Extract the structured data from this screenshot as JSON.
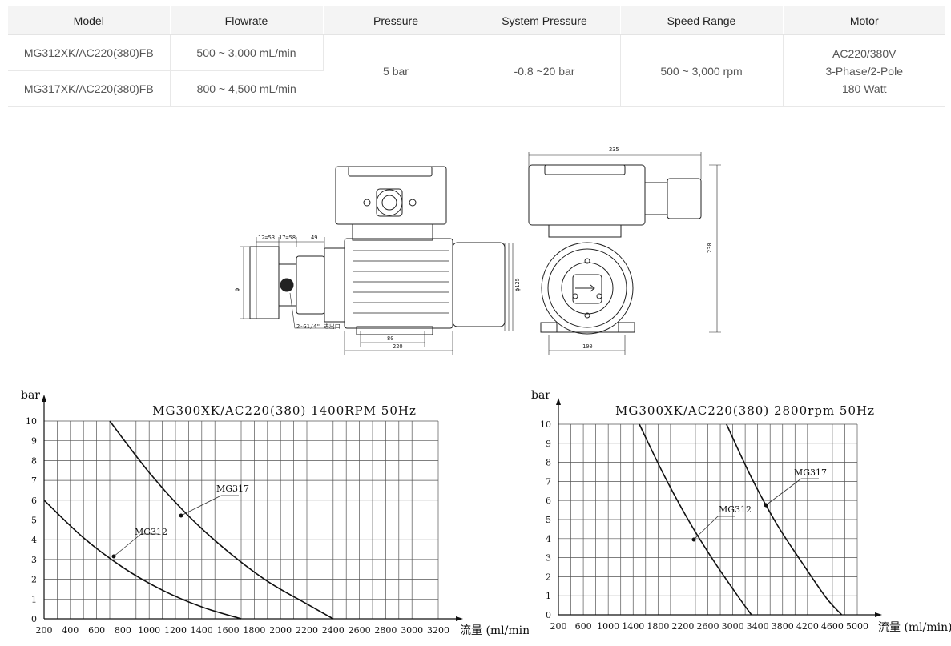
{
  "table": {
    "headers": [
      "Model",
      "Flowrate",
      "Pressure",
      "System Pressure",
      "Speed Range",
      "Motor"
    ],
    "rows": [
      {
        "model": "MG312XK/AC220(380)FB",
        "flowrate": "500 ~ 3,000 mL/min"
      },
      {
        "model": "MG317XK/AC220(380)FB",
        "flowrate": "800 ~ 4,500 mL/min"
      }
    ],
    "pressure": "5 bar",
    "system_pressure": "-0.8 ~20 bar",
    "speed_range": "500 ~ 3,000 rpm",
    "motor": [
      "AC220/380V",
      "3-Phase/2-Pole",
      "180 Watt"
    ]
  },
  "drawing": {
    "dims": [
      "12=53",
      "17=58",
      "49",
      "80",
      "220",
      "235",
      "230",
      "100",
      "ϕ125",
      "ϕ"
    ],
    "port_label": "2-G1/4\" 进出口"
  },
  "chart_data": [
    {
      "type": "line",
      "title": "MG300XK/AC220(380)  1400RPM  50Hz",
      "ylabel": "bar",
      "xlabel": "流量 (ml/min)",
      "x_ticks": [
        200,
        400,
        600,
        800,
        1000,
        1200,
        1400,
        1600,
        1800,
        2000,
        2200,
        2400,
        2600,
        2800,
        3000,
        3200
      ],
      "y_ticks": [
        0,
        1,
        2,
        3,
        4,
        5,
        6,
        7,
        8,
        9,
        10
      ],
      "xlim": [
        200,
        3200
      ],
      "ylim": [
        0,
        10
      ],
      "grid": true,
      "series": [
        {
          "name": "MG312",
          "x": [
            200,
            500,
            800,
            1100,
            1400,
            1700
          ],
          "y": [
            6,
            4.1,
            2.6,
            1.45,
            0.6,
            0
          ]
        },
        {
          "name": "MG317",
          "x": [
            700,
            1000,
            1300,
            1600,
            1900,
            2200,
            2400
          ],
          "y": [
            10,
            7.4,
            5.2,
            3.4,
            1.9,
            0.75,
            0
          ]
        }
      ]
    },
    {
      "type": "line",
      "title": "MG300XK/AC220(380)  2800rpm  50Hz",
      "ylabel": "bar",
      "xlabel": "流量 (ml/min)",
      "x_ticks": [
        200,
        600,
        1000,
        1400,
        1800,
        2200,
        2600,
        3000,
        3400,
        3800,
        4200,
        4600,
        5000
      ],
      "y_ticks": [
        0,
        1,
        2,
        3,
        4,
        5,
        6,
        7,
        8,
        9,
        10
      ],
      "xlim": [
        200,
        5000
      ],
      "ylim": [
        0,
        10
      ],
      "grid": true,
      "series": [
        {
          "name": "MG312",
          "x": [
            1500,
            1900,
            2300,
            2700,
            3100,
            3300
          ],
          "y": [
            10,
            7.3,
            4.9,
            2.8,
            0.9,
            0
          ]
        },
        {
          "name": "MG317",
          "x": [
            2900,
            3300,
            3700,
            4100,
            4500,
            4750
          ],
          "y": [
            10,
            7.2,
            4.8,
            2.8,
            0.9,
            0
          ]
        }
      ]
    }
  ]
}
